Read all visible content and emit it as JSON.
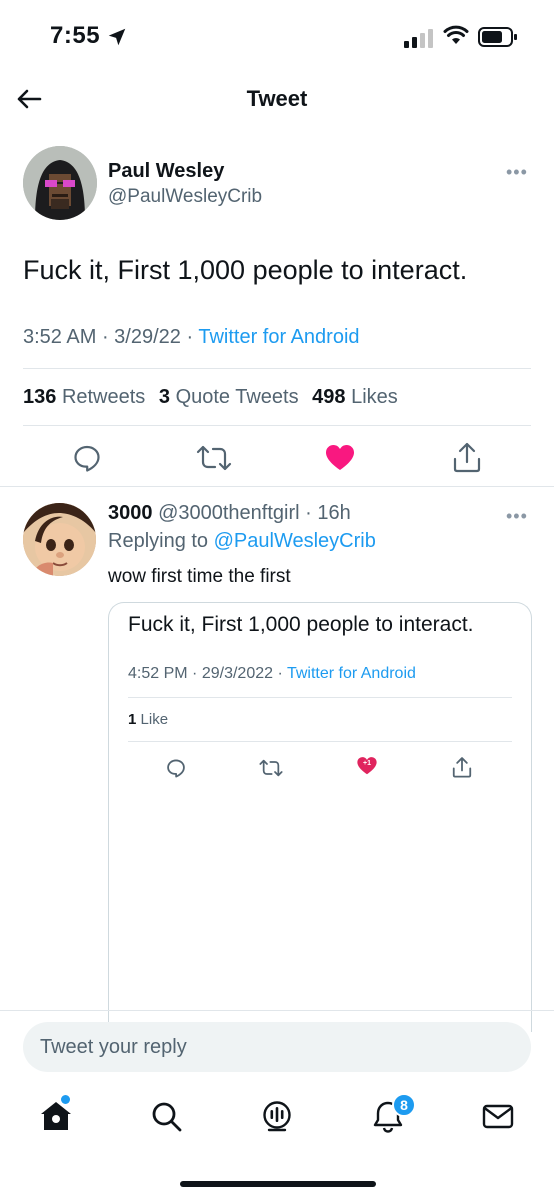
{
  "status_bar": {
    "time": "7:55"
  },
  "header": {
    "title": "Tweet"
  },
  "tweet": {
    "author_name": "Paul Wesley",
    "author_handle": "@PaulWesleyCrib",
    "text": "Fuck it, First 1,000 people to interact.",
    "time": "3:52 AM",
    "date": "3/29/22",
    "source": "Twitter for Android",
    "retweets_count": "136",
    "retweets_label": "Retweets",
    "quote_count": "3",
    "quote_label": "Quote Tweets",
    "likes_count": "498",
    "likes_label": "Likes",
    "liked": true
  },
  "reply": {
    "author_name": "3000",
    "author_handle": "@3000thenftgirl",
    "age": "16h",
    "replying_label": "Replying to",
    "replying_to": "@PaulWesleyCrib",
    "text": "wow first time the first",
    "quote": {
      "text": "Fuck it, First 1,000 people to interact.",
      "time": "4:52 PM",
      "date": "29/3/2022",
      "source": "Twitter for Android",
      "likes_count": "1",
      "likes_label": "Like",
      "heart_badge": "+1"
    }
  },
  "composer": {
    "placeholder": "Tweet your reply"
  },
  "tabbar": {
    "notifications_badge": "8"
  },
  "colors": {
    "accent": "#1d9bf0",
    "like": "#f91880",
    "text": "#0f1419",
    "muted": "#536471"
  }
}
